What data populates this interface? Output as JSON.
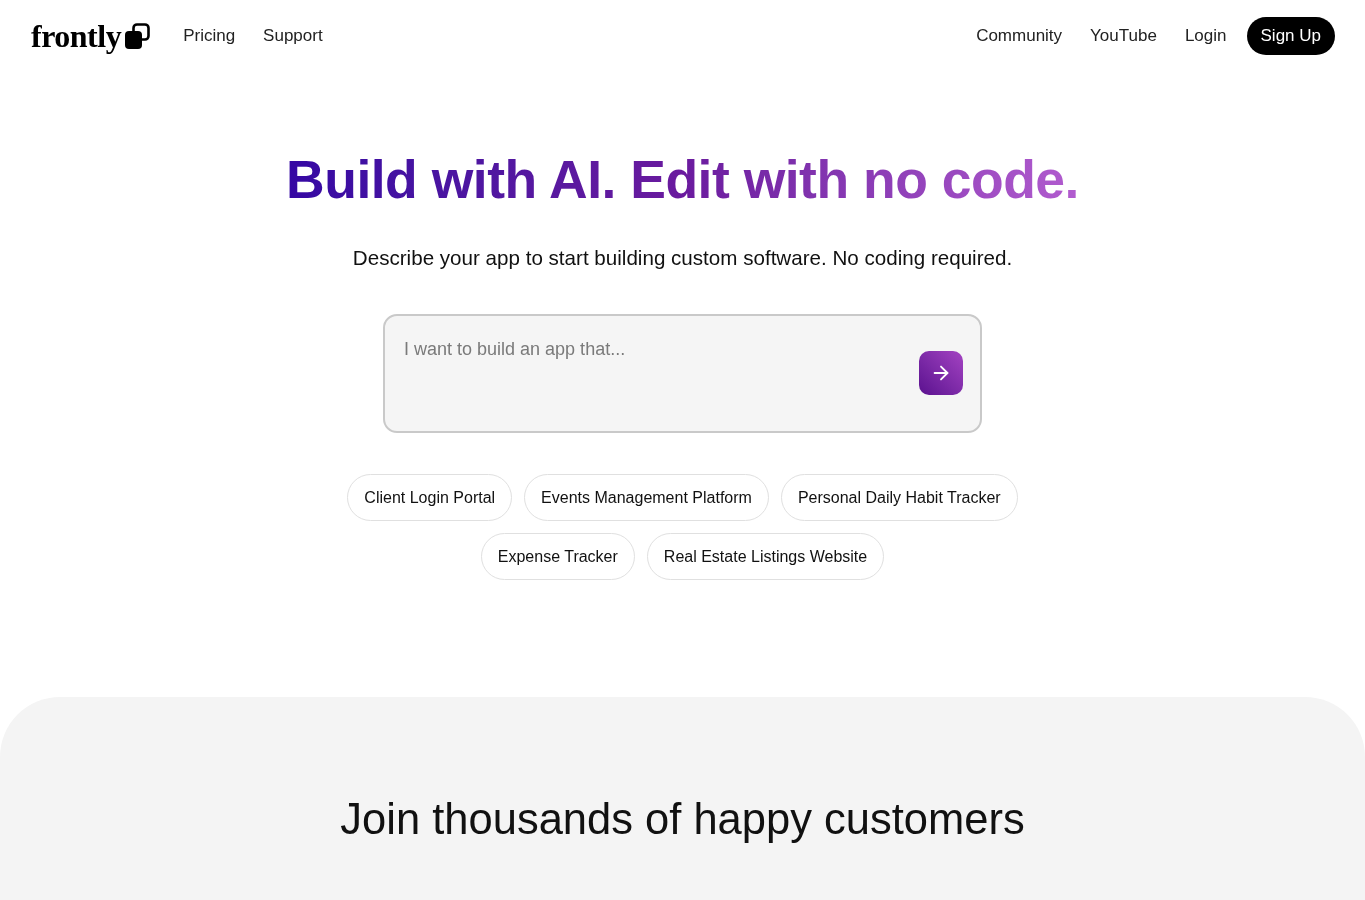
{
  "header": {
    "logo": {
      "text": "frontly"
    },
    "nav_left": [
      {
        "label": "Pricing"
      },
      {
        "label": "Support"
      }
    ],
    "nav_right": [
      {
        "label": "Community"
      },
      {
        "label": "YouTube"
      },
      {
        "label": "Login"
      }
    ],
    "cta": {
      "label": "Sign Up"
    }
  },
  "hero": {
    "title": "Build with AI. Edit with no code.",
    "subtitle": "Describe your app to start building custom software. No coding required.",
    "prompt": {
      "placeholder": "I want to build an app that..."
    },
    "suggestions": [
      {
        "label": "Client Login Portal"
      },
      {
        "label": "Events Management Platform"
      },
      {
        "label": "Personal Daily Habit Tracker"
      },
      {
        "label": "Expense Tracker"
      },
      {
        "label": "Real Estate Listings Website"
      }
    ]
  },
  "customers": {
    "title": "Join thousands of happy customers"
  }
}
